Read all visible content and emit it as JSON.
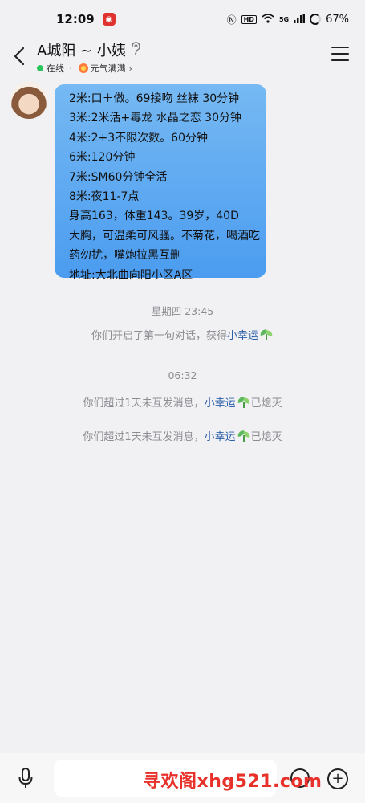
{
  "status_bar": {
    "time": "12:09",
    "network": "5G",
    "hd": "HD",
    "battery": "67%"
  },
  "header": {
    "title": "A城阳 ~ 小姨",
    "online_label": "在线",
    "vitality_label": "元气满满"
  },
  "messages": {
    "bubble_lines": [
      "2米:口＋做。69接吻 丝袜 30分钟",
      "3米:2米活+毒龙 水晶之恋 30分钟",
      "4米:2+3不限次数。60分钟",
      "6米:120分钟",
      "7米:SM60分钟全活",
      "8米:夜11-7点",
      "身高163，体重143。39岁，40D",
      "大胸，可温柔可风骚。不菊花，喝酒吃",
      "药勿扰，嘴炮拉黑互删",
      "地址:大北曲向阳小区A区"
    ],
    "sys1_time": "星期四 23:45",
    "sys1_text": "你们开启了第一句对话，获得",
    "sys1_link": "小幸运",
    "sys2_time": "06:32",
    "sys2_text": "你们超过1天未互发消息，",
    "sys2_link": "小幸运",
    "sys2_suffix": "已熄灭",
    "sys3_text": "你们超过1天未互发消息，",
    "sys3_link": "小幸运",
    "sys3_suffix": "已熄灭"
  },
  "watermark": "寻欢阁xhg521.com",
  "icons": {
    "back": "back-arrow-icon",
    "menu": "hamburger-menu-icon",
    "mic": "microphone-icon",
    "emoji": "emoji-icon",
    "plus": "plus-icon"
  },
  "colors": {
    "bubble": "#5aa8f2",
    "link": "#2b5ea8",
    "online": "#2bc45e",
    "watermark": "#e8312a"
  }
}
